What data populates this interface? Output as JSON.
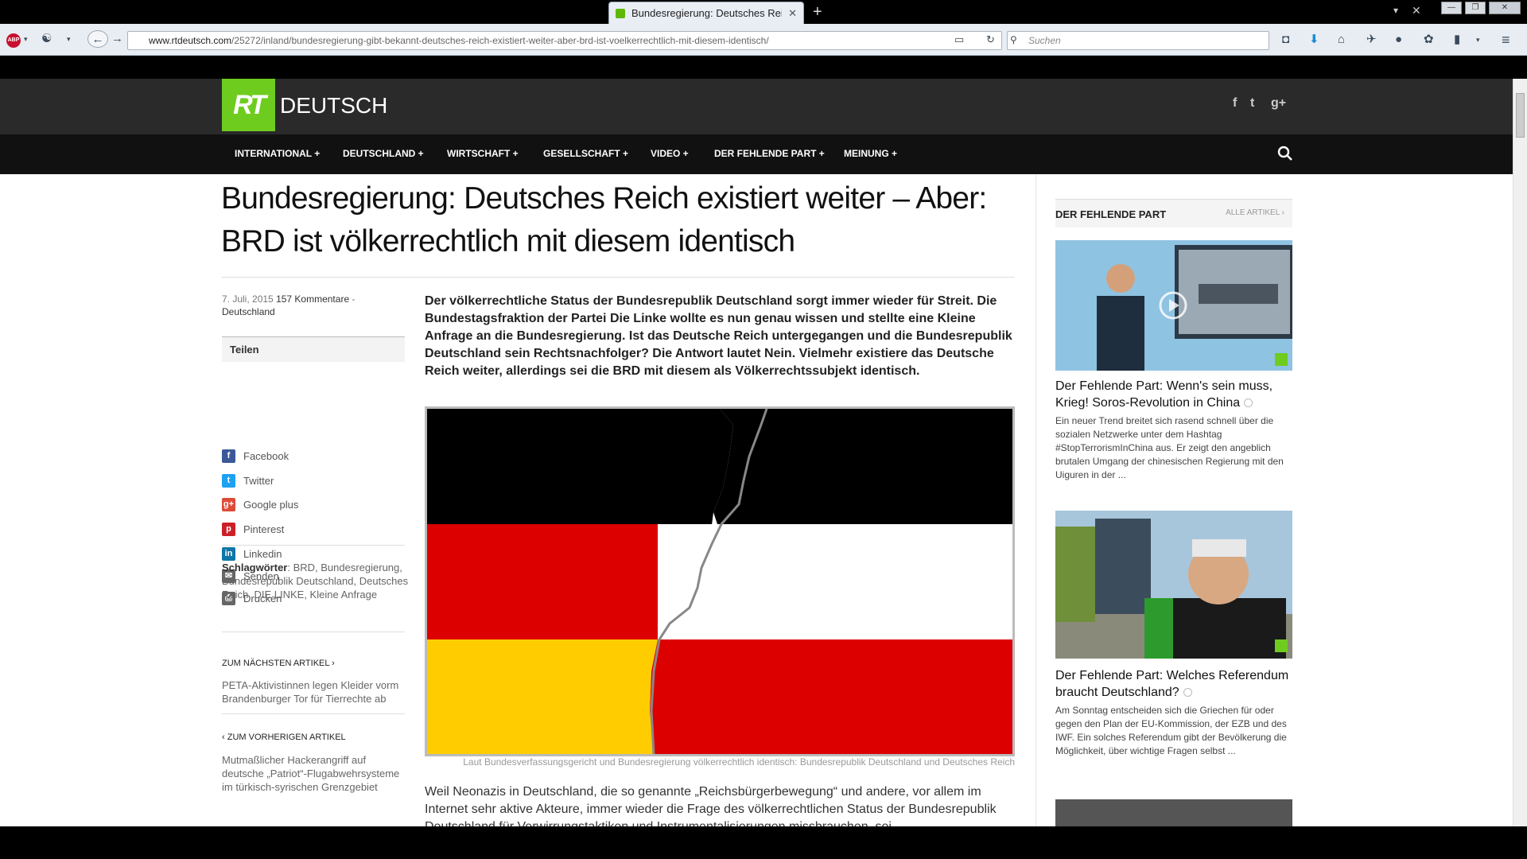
{
  "browser": {
    "tab_title": "Bundesregierung: Deutsches Reich...",
    "url_domain": "www.rtdeutsch.com",
    "url_path": "/25272/inland/bundesregierung-gibt-bekannt-deutsches-reich-existiert-weiter-aber-brd-ist-voelkerrechtlich-mit-diesem-identisch/",
    "search_placeholder": "Suchen",
    "abp_label": "ABP"
  },
  "site": {
    "logo_rt": "RT",
    "logo_deutsch": "DEUTSCH",
    "social": [
      "f",
      "t",
      "g+"
    ],
    "menu": [
      "INTERNATIONAL +",
      "DEUTSCHLAND +",
      "WIRTSCHAFT +",
      "GESELLSCHAFT +",
      "VIDEO +",
      "DER FEHLENDE PART +",
      "MEINUNG +"
    ]
  },
  "article": {
    "headline": "Bundesregierung: Deutsches Reich existiert weiter – Aber: BRD ist völkerrechtlich mit diesem identisch",
    "date": "7. Juli, 2015",
    "comments": "157 Kommentare",
    "meta_sep": "-",
    "section": "Deutschland",
    "lead": "Der völkerrechtliche Status der Bundesrepublik Deutschland sorgt immer wieder für Streit. Die Bundestagsfraktion der Partei Die Linke wollte es nun genau wissen und stellte eine Kleine Anfrage an die Bundesregierung. Ist das Deutsche Reich untergegangen und die Bundesrepublik Deutschland sein Rechtsnachfolger? Die Antwort lautet Nein. Vielmehr existiere das Deutsche Reich weiter, allerdings sei die BRD mit diesem als Völkerrechtssubjekt identisch.",
    "caption": "Laut Bundesverfassungsgericht und Bundesregierung völkerrechtlich identisch: Bundesrepublik Deutschland und Deutsches Reich",
    "body": "Weil Neonazis in Deutschland, die so genannte „Reichsbürgerbewegung“ und andere, vor allem im Internet sehr aktive Akteure, immer wieder die Frage des völkerrechtlichen Status der Bundesrepublik Deutschland für Verwirrungstaktiken und Instrumentalisierungen missbrauchen, sei"
  },
  "share": {
    "heading": "Teilen",
    "items": [
      {
        "label": "Facebook",
        "icon": "facebook-icon",
        "color": "#3b5998",
        "glyph": "f"
      },
      {
        "label": "Twitter",
        "icon": "twitter-icon",
        "color": "#1da1f2",
        "glyph": "t"
      },
      {
        "label": "Google plus",
        "icon": "googleplus-icon",
        "color": "#dd4b39",
        "glyph": "g+"
      },
      {
        "label": "Pinterest",
        "icon": "pinterest-icon",
        "color": "#cb2027",
        "glyph": "p"
      },
      {
        "label": "Linkedin",
        "icon": "linkedin-icon",
        "color": "#0e76a8",
        "glyph": "in"
      },
      {
        "label": "Senden",
        "icon": "mail-icon",
        "color": "#666666",
        "glyph": "✉"
      },
      {
        "label": "Drucken",
        "icon": "print-icon",
        "color": "#666666",
        "glyph": "⎙"
      }
    ]
  },
  "tags": {
    "label": "Schlagwörter",
    "values": ": BRD, Bundesregierung, Bundesrepublik Deutschland, Deutsches Reich, DIE LINKE, Kleine Anfrage"
  },
  "next_article": {
    "label": "ZUM NÄCHSTEN ARTIKEL ›",
    "title": "PETA-Aktivistinnen legen Kleider vorm Brandenburger Tor für Tierrechte ab"
  },
  "prev_article": {
    "label": "‹ ZUM VORHERIGEN ARTIKEL",
    "title": "Mutmaßlicher Hackerangriff auf deutsche „Patriot“-Flugabwehrsysteme im türkisch-syrischen Grenzgebiet"
  },
  "sidebar": {
    "heading": "DER FEHLENDE PART",
    "all_label": "ALLE ARTIKEL ›",
    "items": [
      {
        "title": "Der Fehlende Part: Wenn's sein muss, Krieg! Soros-Revolution in China",
        "text": "Ein neuer Trend breitet sich rasend schnell über die sozialen Netzwerke unter dem Hashtag #StopTerrorismInChina aus. Er zeigt den angeblich brutalen Umgang der chinesischen Regierung mit den Uiguren in der ..."
      },
      {
        "title": "Der Fehlende Part: Welches Referendum braucht Deutschland?",
        "text": "Am Sonntag entscheiden sich die Griechen für oder gegen den Plan der EU-Kommission, der EZB und des IWF. Ein solches Referendum gibt der Bevölkerung die Möglichkeit, über wichtige Fragen selbst ..."
      }
    ]
  },
  "colors": {
    "rt_green": "#6ecc1f",
    "flag_black": "#000000",
    "flag_red": "#dd0000",
    "flag_gold": "#ffcc00",
    "flag_white": "#ffffff"
  }
}
